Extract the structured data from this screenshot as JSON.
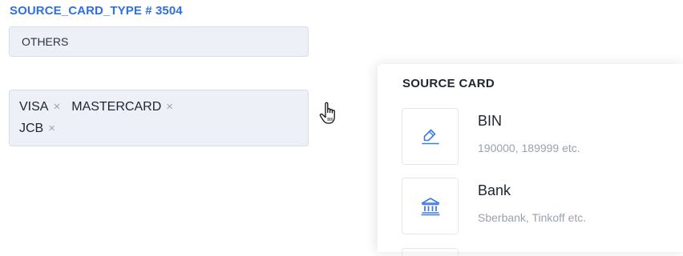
{
  "field": {
    "title": "SOURCE_CARD_TYPE # 3504",
    "single_value": "OTHERS"
  },
  "multi_select": {
    "rows": [
      [
        {
          "label": "VISA",
          "remove": "×"
        },
        {
          "label": "MASTERCARD",
          "remove": "×"
        }
      ],
      [
        {
          "label": "JCB",
          "remove": "×"
        }
      ]
    ]
  },
  "panel": {
    "title": "SOURCE CARD",
    "options": [
      {
        "name": "BIN",
        "description": "190000, 189999 etc.",
        "icon": "edit-icon"
      },
      {
        "name": "Bank",
        "description": "Sberbank, Tinkoff etc.",
        "icon": "bank-icon"
      }
    ]
  },
  "colors": {
    "accent": "#2f6fe0",
    "field_bg": "#edf1f7",
    "muted_text": "#9aa2ad"
  }
}
